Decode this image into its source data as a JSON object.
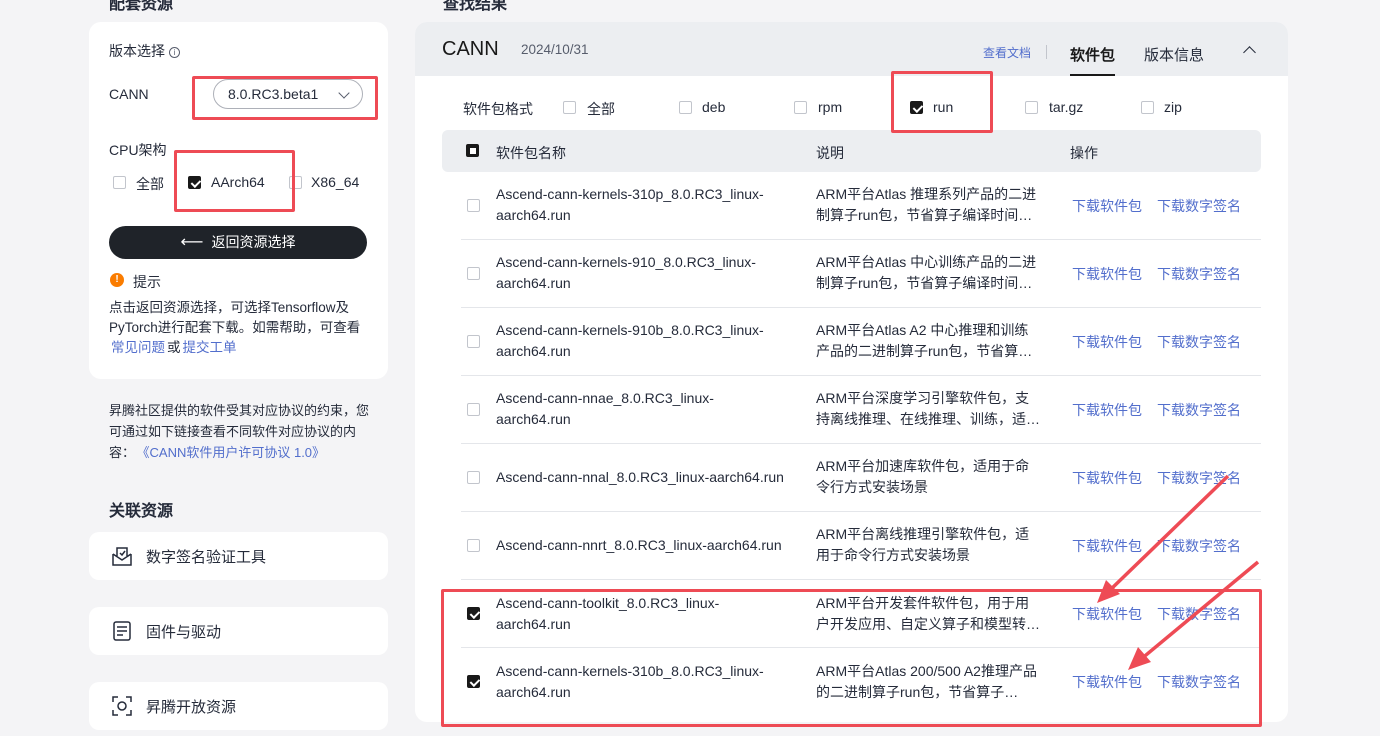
{
  "left": {
    "section_title": "配套资源",
    "version_label": "版本选择",
    "info_icon": "i",
    "product_label": "CANN",
    "version_value": "8.0.RC3.beta1",
    "cpu_label": "CPU架构",
    "cpu_options": [
      {
        "label": "全部",
        "checked": false
      },
      {
        "label": "AArch64",
        "checked": true
      },
      {
        "label": "X86_64",
        "checked": false
      }
    ],
    "back_button": "返回资源选择",
    "tip_title": "提示",
    "tip_text": "点击返回资源选择，可选择Tensorflow及PyTorch进行配套下载。如需帮助，可查看",
    "tip_link1": "常见问题",
    "tip_or": "或",
    "tip_link2": "提交工单",
    "license_text": "昇腾社区提供的软件受其对应协议的约束，您可通过如下链接查看不同软件对应协议的内容：",
    "license_link": "《CANN软件用户许可协议 1.0》",
    "related_title": "关联资源",
    "related": [
      {
        "label": "数字签名验证工具",
        "icon": "signature-icon"
      },
      {
        "label": "固件与驱动",
        "icon": "firmware-icon"
      },
      {
        "label": "昇腾开放资源",
        "icon": "open-resource-icon"
      }
    ]
  },
  "right": {
    "section_title": "查找结果",
    "product": "CANN",
    "date": "2024/10/31",
    "doc_link": "查看文档",
    "tabs": [
      "软件包",
      "版本信息"
    ],
    "format_label": "软件包格式",
    "formats": [
      {
        "label": "全部",
        "checked": false
      },
      {
        "label": "deb",
        "checked": false
      },
      {
        "label": "rpm",
        "checked": false
      },
      {
        "label": "run",
        "checked": true
      },
      {
        "label": "tar.gz",
        "checked": false
      },
      {
        "label": "zip",
        "checked": false
      }
    ],
    "columns": [
      "软件包名称",
      "说明",
      "操作"
    ],
    "rows": [
      {
        "name": "Ascend-cann-kernels-310p_8.0.RC3_linux-aarch64.run",
        "desc": "ARM平台Atlas 推理系列产品的二进制算子run包，节省算子编译时间…",
        "checked": false,
        "download": "下载软件包",
        "signature": "下载数字签名"
      },
      {
        "name": "Ascend-cann-kernels-910_8.0.RC3_linux-aarch64.run",
        "desc": "ARM平台Atlas 中心训练产品的二进制算子run包，节省算子编译时间…",
        "checked": false,
        "download": "下载软件包",
        "signature": "下载数字签名"
      },
      {
        "name": "Ascend-cann-kernels-910b_8.0.RC3_linux-aarch64.run",
        "desc": "ARM平台Atlas A2 中心推理和训练产品的二进制算子run包，节省算…",
        "checked": false,
        "download": "下载软件包",
        "signature": "下载数字签名"
      },
      {
        "name": "Ascend-cann-nnae_8.0.RC3_linux-aarch64.run",
        "desc": "ARM平台深度学习引擎软件包，支持离线推理、在线推理、训练，适…",
        "checked": false,
        "download": "下载软件包",
        "signature": "下载数字签名"
      },
      {
        "name": "Ascend-cann-nnal_8.0.RC3_linux-aarch64.run",
        "desc": "ARM平台加速库软件包，适用于命令行方式安装场景",
        "checked": false,
        "download": "下载软件包",
        "signature": "下载数字签名"
      },
      {
        "name": "Ascend-cann-nnrt_8.0.RC3_linux-aarch64.run",
        "desc": "ARM平台离线推理引擎软件包，适用于命令行方式安装场景",
        "checked": false,
        "download": "下载软件包",
        "signature": "下载数字签名"
      },
      {
        "name": "Ascend-cann-toolkit_8.0.RC3_linux-aarch64.run",
        "desc": "ARM平台开发套件软件包，用于用户开发应用、自定义算子和模型转…",
        "checked": true,
        "download": "下载软件包",
        "signature": "下载数字签名"
      },
      {
        "name": "Ascend-cann-kernels-310b_8.0.RC3_linux-aarch64.run",
        "desc": "ARM平台Atlas 200/500 A2推理产品的二进制算子run包，节省算子…",
        "checked": true,
        "download": "下载软件包",
        "signature": "下载数字签名"
      }
    ]
  },
  "annotation_color": "#ee4b55"
}
